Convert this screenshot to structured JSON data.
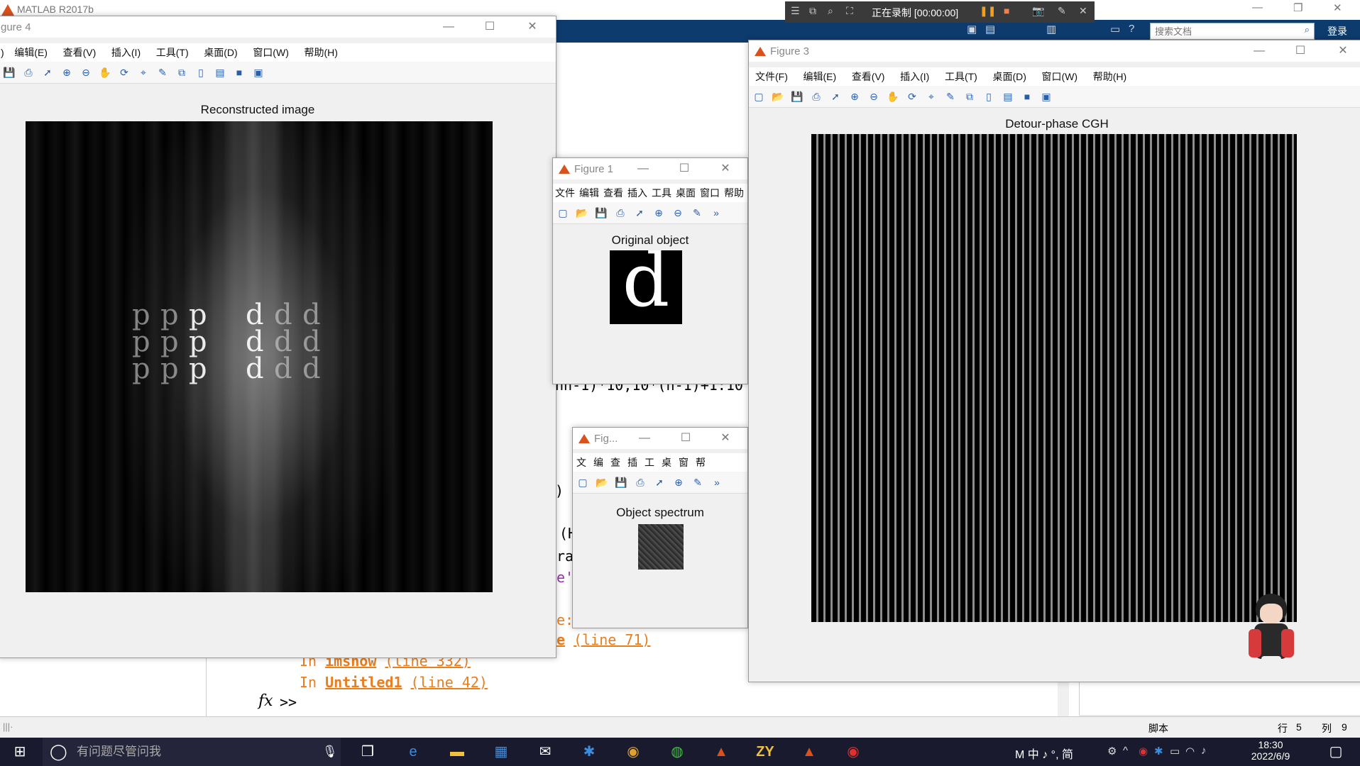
{
  "matlab": {
    "title": "MATLAB R2017b",
    "search_placeholder": "搜索文档",
    "login_label": "登录"
  },
  "recorder": {
    "status_text": "正在录制 [00:00:00]"
  },
  "command_window": {
    "partial_line_1": "nn-1)*10,10*(n-1)+1:10",
    "partial_paren": ")",
    "partial_h": "(H",
    "partial_ra": "ra",
    "partial_e": "e'",
    "partial_colon": "e:",
    "line_imshow_prefix": "In ",
    "line_imshow_func": "imshow",
    "line_imshow_loc": "(line 332)",
    "line_untitled_prefix": "In ",
    "line_untitled_func": "Untitled1",
    "line_untitled_loc": "(line 42)",
    "partial_line71_e": "e",
    "partial_line71_loc": "(line 71)",
    "fx_symbol": "fx",
    "prompt": ">>"
  },
  "status_bar": {
    "mode": "脚本",
    "row_label": "行",
    "row_value": "5",
    "col_label": "列",
    "col_value": "9"
  },
  "figure4": {
    "title": "gure 4",
    "menus": [
      "编辑(E)",
      "查看(V)",
      "插入(I)",
      "工具(T)",
      "桌面(D)",
      "窗口(W)",
      "帮助(H)"
    ],
    "menu_leading": ")",
    "plot_title": "Reconstructed image"
  },
  "figure1": {
    "title": "Figure 1",
    "menus": [
      "文件",
      "编辑",
      "查看",
      "插入",
      "工具",
      "桌面",
      "窗口",
      "帮助"
    ],
    "plot_title": "Original object",
    "glyph": "d"
  },
  "figure2": {
    "title": "Fig...",
    "menus": [
      "文",
      "编",
      "查",
      "插",
      "工",
      "桌",
      "窗",
      "帮"
    ],
    "plot_title": "Object spectrum"
  },
  "figure3": {
    "title": "Figure 3",
    "menus": [
      "文件(F)",
      "编辑(E)",
      "查看(V)",
      "插入(I)",
      "工具(T)",
      "桌面(D)",
      "窗口(W)",
      "帮助(H)"
    ],
    "plot_title": "Detour-phase CGH"
  },
  "reconstruction_letters": [
    "p",
    "p",
    "p",
    "d",
    "d",
    "d"
  ],
  "taskbar": {
    "search_placeholder": "有问题尽管问我",
    "time": "18:30",
    "date": "2022/6/9",
    "ime_indicators": "M 中 ♪ °, 简"
  },
  "colors": {
    "ribbon": "#0d3b6e",
    "matlab_orange": "#d9521e",
    "link_orange": "#e67e22",
    "taskbar": "#1a1a2e"
  }
}
